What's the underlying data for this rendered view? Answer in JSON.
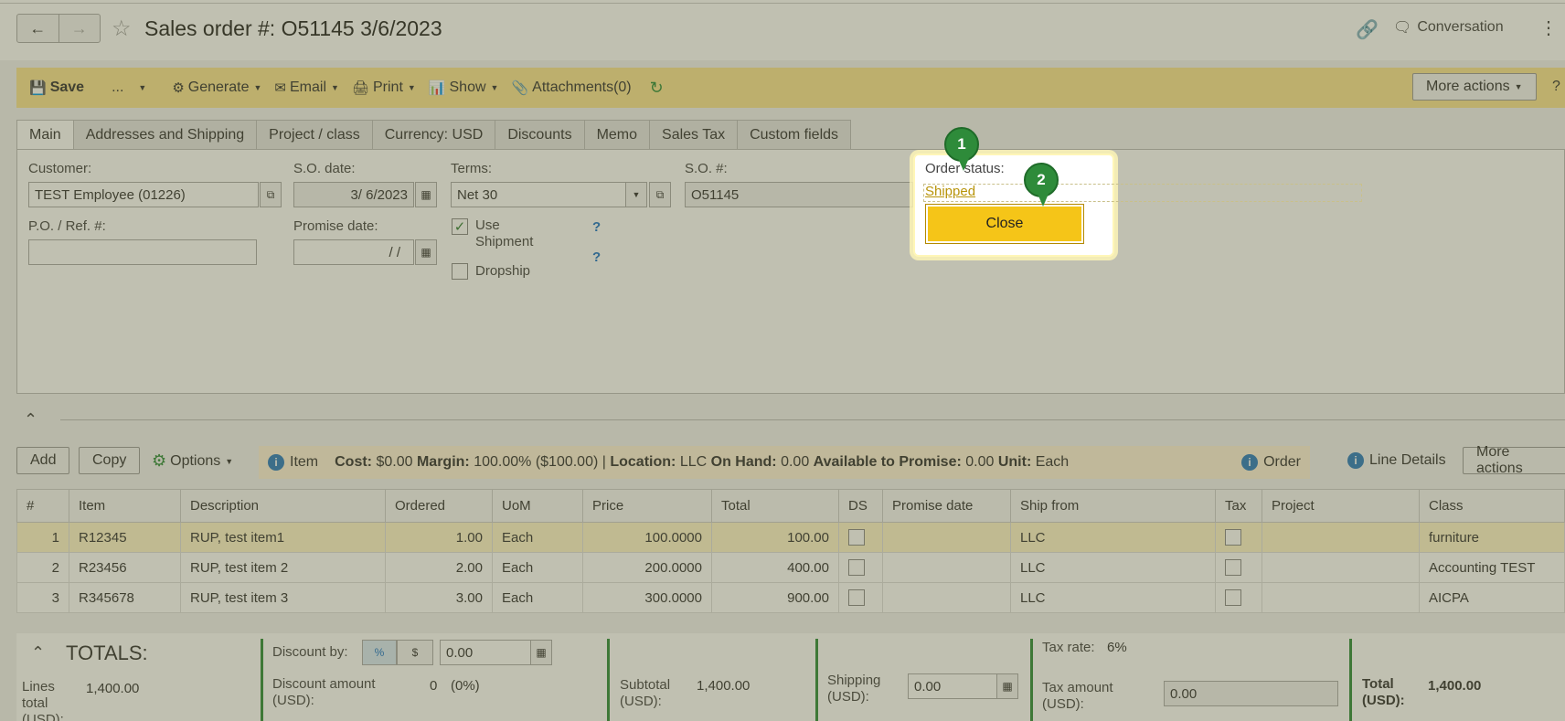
{
  "header": {
    "title": "Sales order #: O51145 3/6/2023",
    "conversation_label": "Conversation"
  },
  "toolbar": {
    "save": "Save",
    "ellipsis": "...",
    "generate": "Generate",
    "email": "Email",
    "print": "Print",
    "show": "Show",
    "attachments": "Attachments(0)",
    "more_actions": "More actions",
    "help": "?"
  },
  "tabs": [
    "Main",
    "Addresses and Shipping",
    "Project / class",
    "Currency: USD",
    "Discounts",
    "Memo",
    "Sales Tax",
    "Custom fields"
  ],
  "form": {
    "customer_label": "Customer:",
    "customer_value": "TEST Employee (01226)",
    "so_date_label": "S.O. date:",
    "so_date_value": "3/ 6/2023",
    "terms_label": "Terms:",
    "terms_value": "Net 30",
    "so_num_label": "S.O. #:",
    "so_num_value": "O51145",
    "po_label": "P.O. / Ref. #:",
    "po_value": "",
    "promise_label": "Promise date:",
    "promise_value": "/  /",
    "use_shipment": "Use Shipment",
    "dropship": "Dropship",
    "help_q": "?"
  },
  "popup": {
    "order_status_label": "Order status:",
    "order_status_value": "Shipped",
    "close_button": "Close",
    "badge1": "1",
    "badge2": "2"
  },
  "grid_toolbar": {
    "add": "Add",
    "copy": "Copy",
    "options": "Options",
    "item_label": "Item",
    "cost_label": "Cost:",
    "cost_value": "$0.00",
    "margin_label": "Margin:",
    "margin_value": "100.00% ($100.00) |",
    "location_label": "Location:",
    "location_value": "LLC",
    "onhand_label": "On Hand:",
    "onhand_value": "0.00",
    "atp_label": "Available to Promise:",
    "atp_value": "0.00",
    "unit_label": "Unit:",
    "unit_value": "Each",
    "order_label": "Order",
    "line_details": "Line Details",
    "more_actions": "More actions"
  },
  "grid": {
    "headers": [
      "#",
      "Item",
      "Description",
      "Ordered",
      "UoM",
      "Price",
      "Total",
      "DS",
      "Promise date",
      "Ship from",
      "Tax",
      "Project",
      "Class"
    ],
    "rows": [
      {
        "n": "1",
        "item": "R12345",
        "desc": "RUP, test item1",
        "ordered": "1.00",
        "uom": "Each",
        "price": "100.0000",
        "total": "100.00",
        "ship": "LLC",
        "class": "furniture"
      },
      {
        "n": "2",
        "item": "R23456",
        "desc": "RUP, test item 2",
        "ordered": "2.00",
        "uom": "Each",
        "price": "200.0000",
        "total": "400.00",
        "ship": "LLC",
        "class": "Accounting TEST"
      },
      {
        "n": "3",
        "item": "R345678",
        "desc": "RUP, test item 3",
        "ordered": "3.00",
        "uom": "Each",
        "price": "300.0000",
        "total": "900.00",
        "ship": "LLC",
        "class": "AICPA"
      }
    ]
  },
  "totals": {
    "heading": "TOTALS:",
    "lines_total_label": "Lines total (USD):",
    "lines_total_value": "1,400.00",
    "discount_by_label": "Discount by:",
    "pct": "%",
    "dollar": "$",
    "discount_value": "0.00",
    "discount_amount_label": "Discount amount (USD):",
    "discount_amount_value": "0",
    "discount_amount_pct": "(0%)",
    "subtotal_label": "Subtotal (USD):",
    "subtotal_value": "1,400.00",
    "shipping_label": "Shipping (USD):",
    "shipping_value": "0.00",
    "tax_rate_label": "Tax rate:",
    "tax_rate_value": "6%",
    "tax_amount_label": "Tax amount (USD):",
    "tax_amount_value": "0.00",
    "total_label": "Total (USD):",
    "total_value": "1,400.00"
  }
}
